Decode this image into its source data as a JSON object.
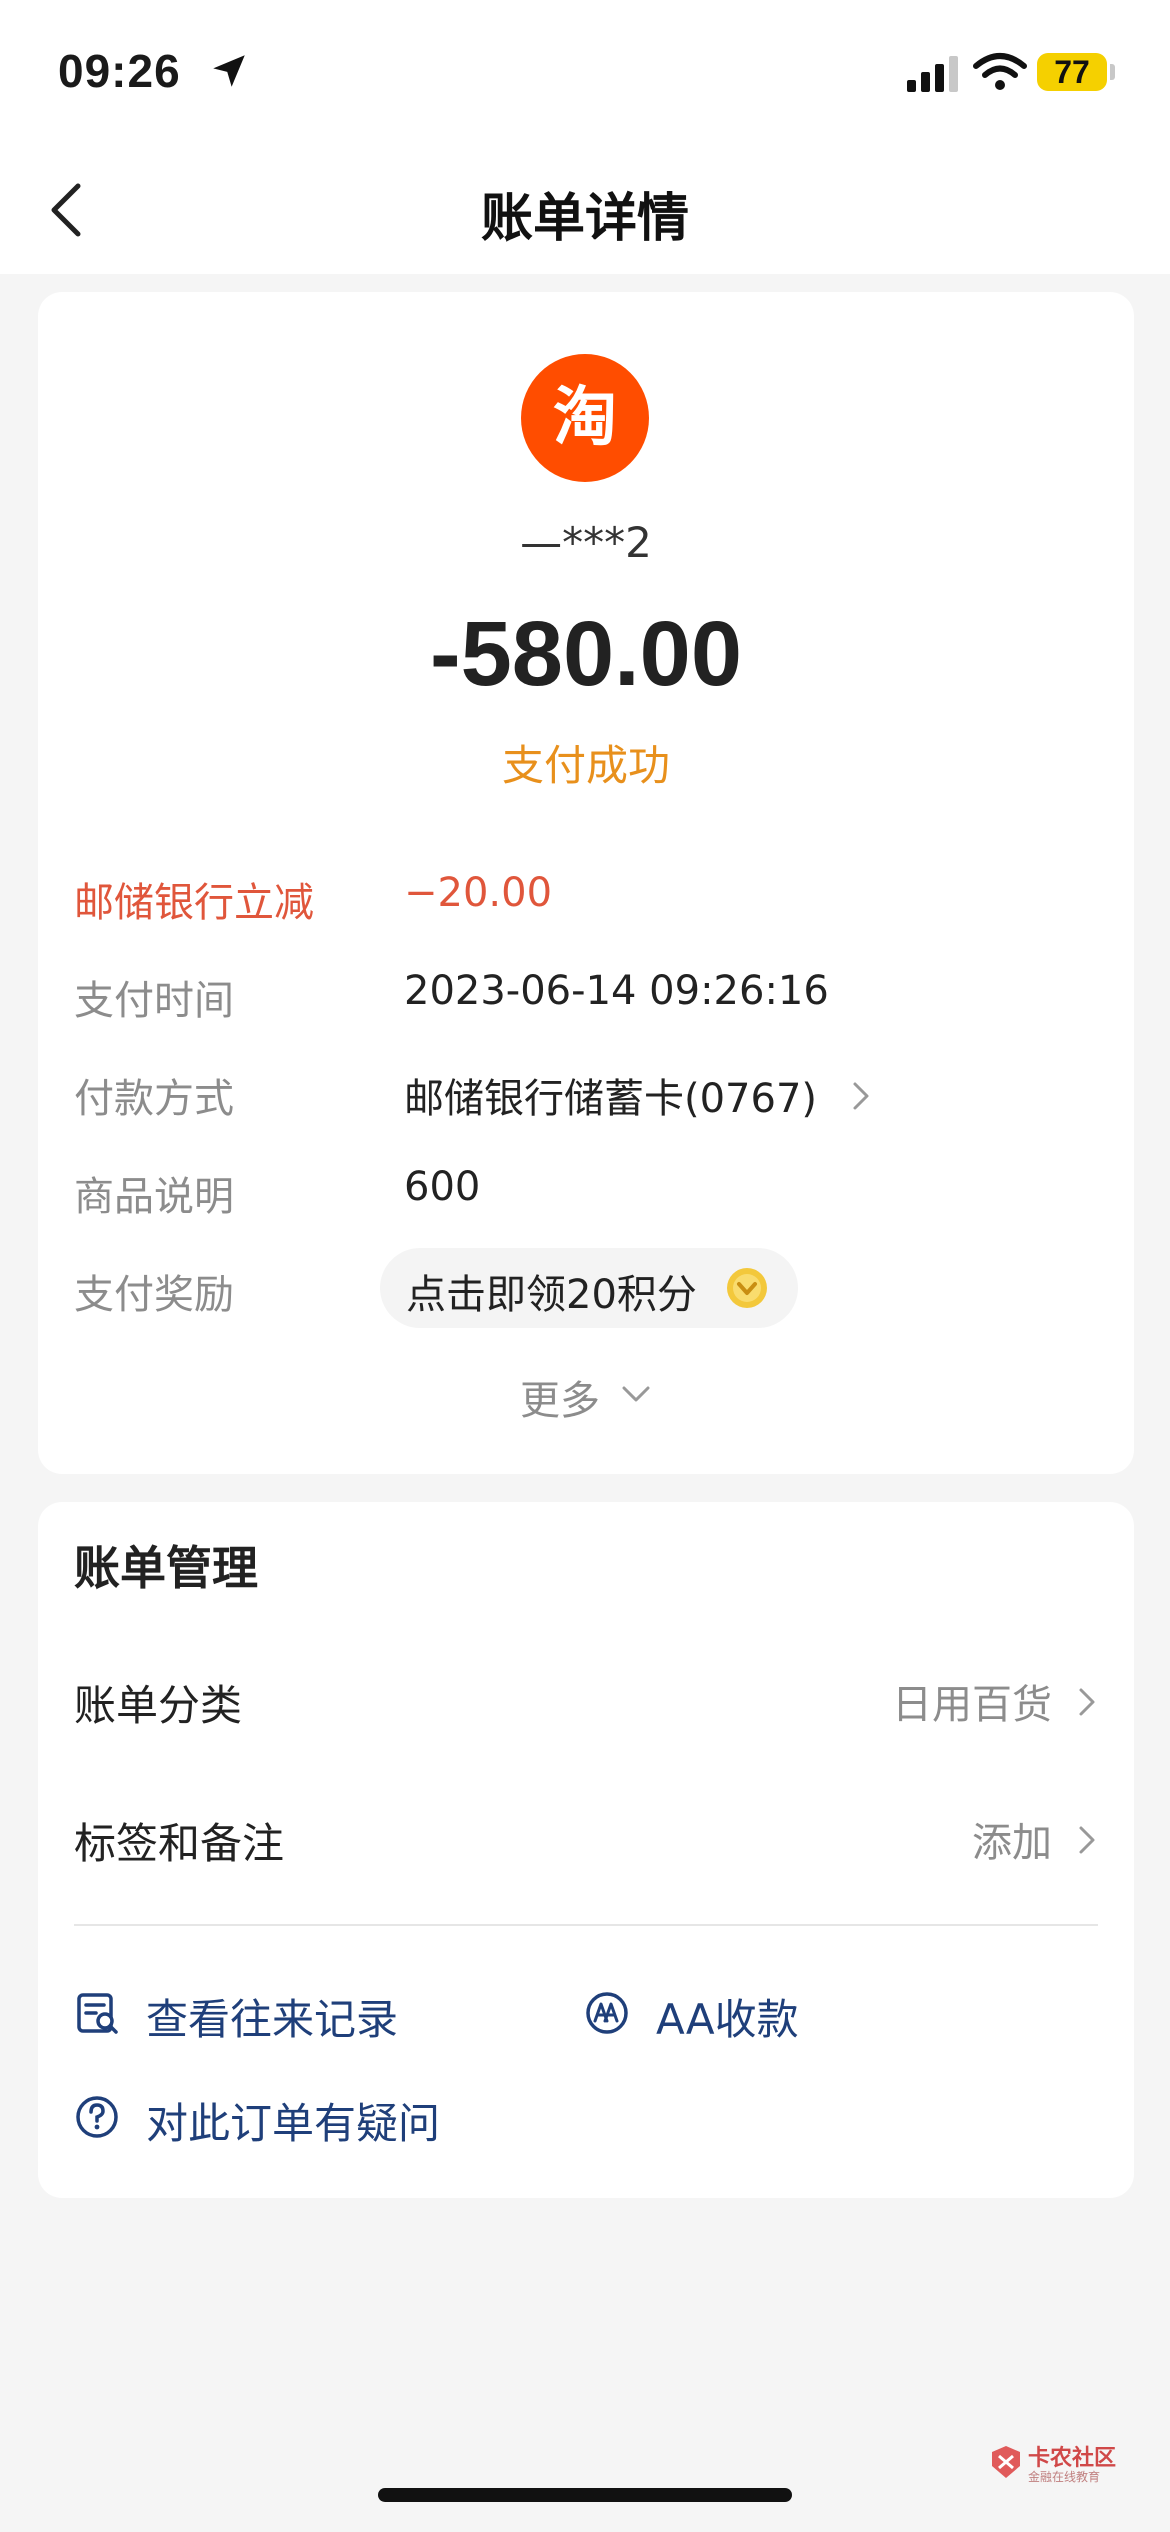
{
  "status_bar": {
    "time": "09:26",
    "battery_level": "77",
    "icons": [
      "location-arrow-icon",
      "cellular-signal-icon",
      "wifi-icon",
      "battery-icon"
    ]
  },
  "nav": {
    "title": "账单详情",
    "back_icon": "chevron-left-icon"
  },
  "transaction": {
    "merchant_logo_text": "淘",
    "merchant_logo_color": "#ff4d00",
    "merchant_name": "—***2",
    "amount": "-580.00",
    "status": "支付成功",
    "status_color": "#e8901c"
  },
  "details": {
    "discount_label": "邮储银行立减",
    "discount_value": "−20.00",
    "discount_color": "#e0563b",
    "time_label": "支付时间",
    "time_value": "2023-06-14 09:26:16",
    "method_label": "付款方式",
    "method_value": "邮储银行储蓄卡(0767)",
    "desc_label": "商品说明",
    "desc_value": "600",
    "reward_label": "支付奖励",
    "reward_value": "点击即领20积分",
    "more_label": "更多"
  },
  "management": {
    "title": "账单管理",
    "category_label": "账单分类",
    "category_value": "日用百货",
    "tags_label": "标签和备注",
    "tags_value": "添加",
    "actions": {
      "records": "查看往来记录",
      "aa": "AA收款",
      "question": "对此订单有疑问"
    },
    "action_color": "#1f3f7a"
  },
  "watermark": {
    "name": "卡农社区",
    "sub": "金融在线教育"
  }
}
